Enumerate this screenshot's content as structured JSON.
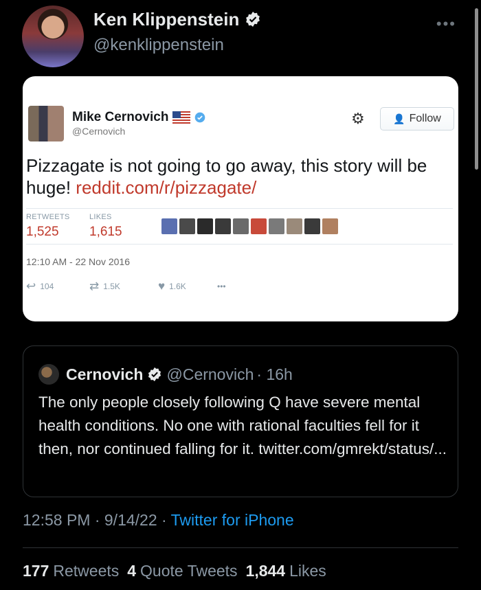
{
  "author": {
    "name": "Ken Klippenstein",
    "handle": "@kenklippenstein"
  },
  "embedded": {
    "name": "Mike Cernovich",
    "handle": "@Cernovich",
    "follow_label": "Follow",
    "text_main": "Pizzagate is not going to go away, this story will be huge! ",
    "text_link": "reddit.com/r/pizzagate/",
    "retweets_label": "RETWEETS",
    "retweets_value": "1,525",
    "likes_label": "LIKES",
    "likes_value": "1,615",
    "liker_colors": [
      "#5a6fb0",
      "#4a4a4a",
      "#2a2a2a",
      "#3a3a3a",
      "#6a6a6a",
      "#c84a3a",
      "#7a7a7a",
      "#9a8a7a",
      "#3a3a3a",
      "#b08060"
    ],
    "date": "12:10 AM - 22 Nov 2016",
    "replies": "104",
    "rts_short": "1.5K",
    "likes_short": "1.6K"
  },
  "quote": {
    "name": "Cernovich",
    "handle": "@Cernovich",
    "time": "· 16h",
    "text": "The only people closely following Q have severe mental health conditions. No one with rational faculties fell for it then, nor continued falling for it. twitter.com/gmrekt/status/..."
  },
  "meta": {
    "time": "12:58 PM · 9/14/22 · ",
    "source": "Twitter for iPhone"
  },
  "stats": {
    "retweets_count": "177",
    "retweets_label": "Retweets",
    "quotes_count": "4",
    "quotes_label": "Quote Tweets",
    "likes_count": "1,844",
    "likes_label": "Likes"
  },
  "colors": {
    "verified": "#e7e9ea",
    "link": "#1d9bf0",
    "card_link": "#c0392b"
  }
}
